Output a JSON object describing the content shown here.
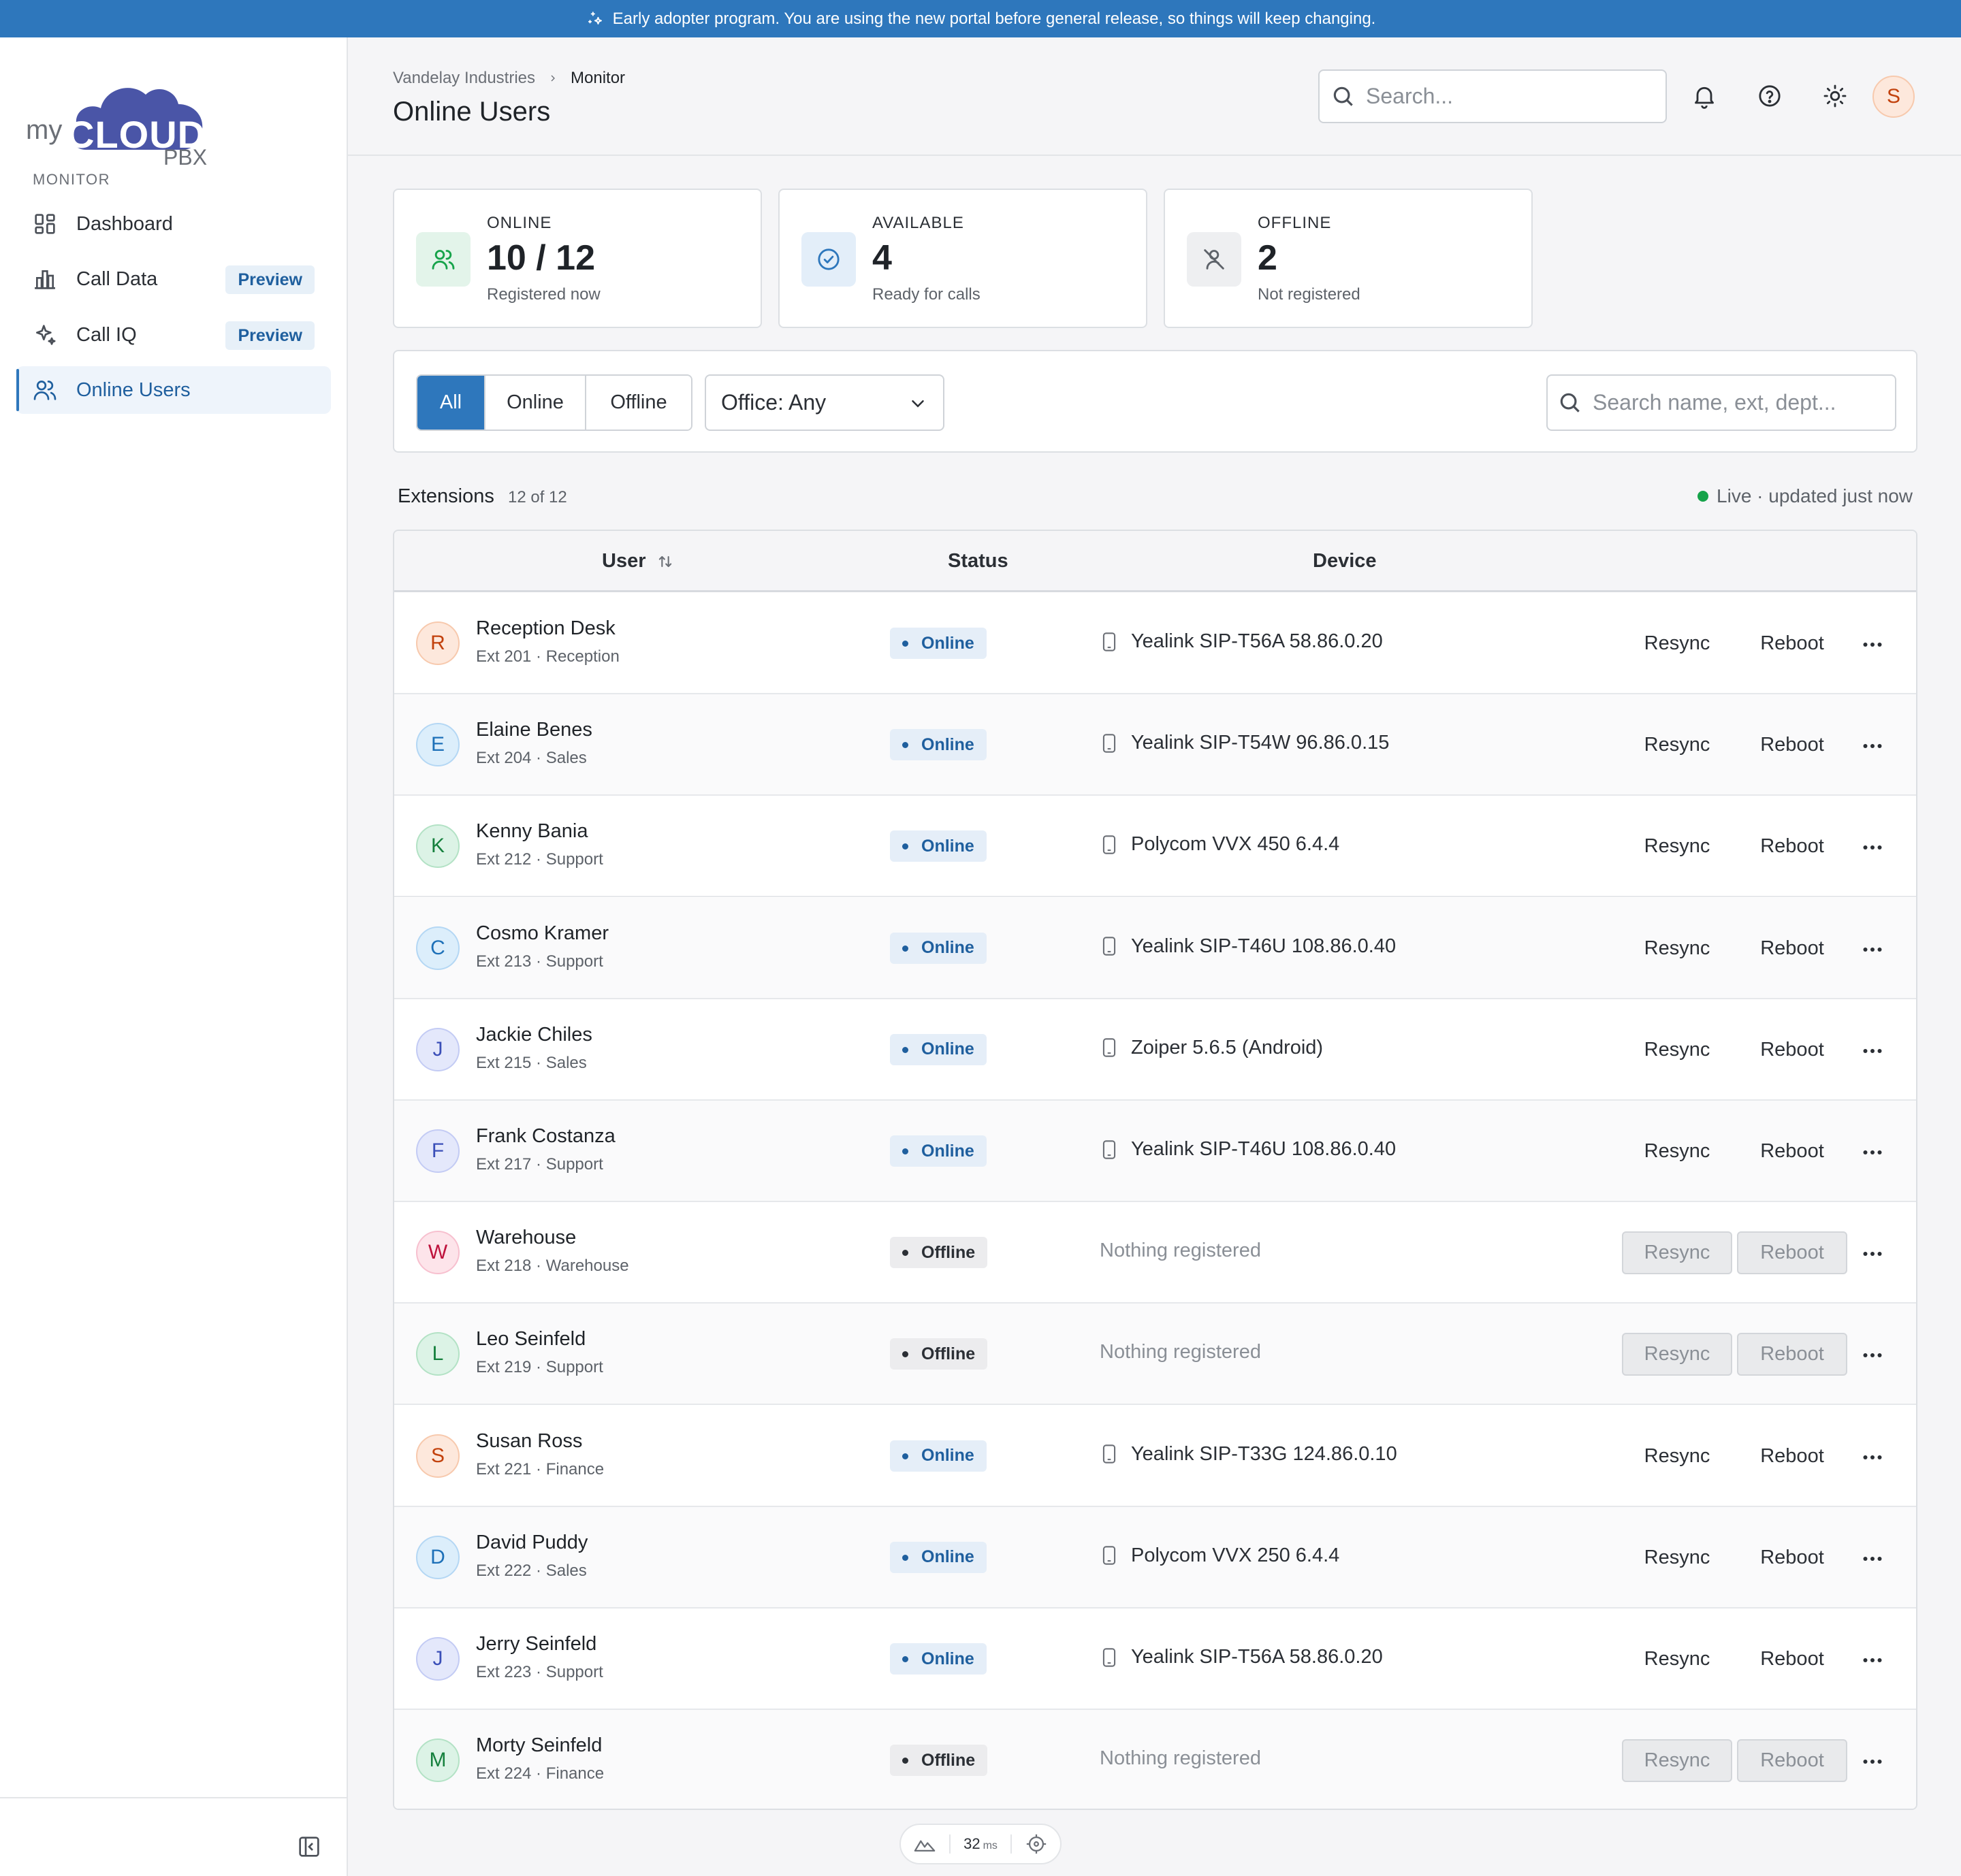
{
  "banner": {
    "text": "Early adopter program. You are using the new portal before general release, so things will keep changing."
  },
  "brand": {
    "prefix": "my",
    "name": "CLOUD",
    "suffix": "PBX",
    "color": "#4a55a7"
  },
  "sidebar": {
    "section": "MONITOR",
    "items": [
      {
        "label": "Dashboard",
        "icon": "dashboard-icon",
        "badge": ""
      },
      {
        "label": "Call Data",
        "icon": "bar-chart-icon",
        "badge": "Preview"
      },
      {
        "label": "Call IQ",
        "icon": "sparkles-icon",
        "badge": "Preview"
      },
      {
        "label": "Online Users",
        "icon": "users-icon",
        "badge": "",
        "active": true
      }
    ]
  },
  "header": {
    "breadcrumb": [
      "Vandelay Industries",
      "Monitor"
    ],
    "title": "Online Users",
    "search_placeholder": "Search...",
    "avatar_initial": "S"
  },
  "stats": [
    {
      "label": "ONLINE",
      "value": "10 / 12",
      "sub": "Registered now",
      "icon": "users-icon",
      "color": "#16a34a"
    },
    {
      "label": "AVAILABLE",
      "value": "4",
      "sub": "Ready for calls",
      "icon": "check-circle-icon",
      "color": "#2e77bc"
    },
    {
      "label": "OFFLINE",
      "value": "2",
      "sub": "Not registered",
      "icon": "user-off-icon",
      "color": "#6b6f76"
    }
  ],
  "filters": {
    "segments": [
      "All",
      "Online",
      "Offline"
    ],
    "active_segment": "All",
    "office": "Office: Any",
    "search_placeholder": "Search name, ext, dept..."
  },
  "extensions": {
    "title": "Extensions",
    "count": "12 of 12",
    "live": "Live · updated just now"
  },
  "table": {
    "columns": [
      "User",
      "Status",
      "Device"
    ],
    "actions": {
      "resync": "Resync",
      "reboot": "Reboot"
    },
    "rows": [
      {
        "initial": "R",
        "name": "Reception Desk",
        "meta": "Ext 201 · Reception",
        "status": "Online",
        "device": "Yealink SIP-T56A 58.86.0.20",
        "avatar": "orange"
      },
      {
        "initial": "E",
        "name": "Elaine Benes",
        "meta": "Ext 204 · Sales",
        "status": "Online",
        "device": "Yealink SIP-T54W 96.86.0.15",
        "avatar": "blue"
      },
      {
        "initial": "K",
        "name": "Kenny Bania",
        "meta": "Ext 212 · Support",
        "status": "Online",
        "device": "Polycom VVX 450 6.4.4",
        "avatar": "green"
      },
      {
        "initial": "C",
        "name": "Cosmo Kramer",
        "meta": "Ext 213 · Support",
        "status": "Online",
        "device": "Yealink SIP-T46U 108.86.0.40",
        "avatar": "blue"
      },
      {
        "initial": "J",
        "name": "Jackie Chiles",
        "meta": "Ext 215 · Sales",
        "status": "Online",
        "device": "Zoiper 5.6.5 (Android)",
        "avatar": "indigo"
      },
      {
        "initial": "F",
        "name": "Frank Costanza",
        "meta": "Ext 217 · Support",
        "status": "Online",
        "device": "Yealink SIP-T46U 108.86.0.40",
        "avatar": "indigo"
      },
      {
        "initial": "W",
        "name": "Warehouse",
        "meta": "Ext 218 · Warehouse",
        "status": "Offline",
        "device": "Nothing registered",
        "avatar": "pink"
      },
      {
        "initial": "L",
        "name": "Leo Seinfeld",
        "meta": "Ext 219 · Support",
        "status": "Offline",
        "device": "Nothing registered",
        "avatar": "green"
      },
      {
        "initial": "S",
        "name": "Susan Ross",
        "meta": "Ext 221 · Finance",
        "status": "Online",
        "device": "Yealink SIP-T33G 124.86.0.10",
        "avatar": "orange"
      },
      {
        "initial": "D",
        "name": "David Puddy",
        "meta": "Ext 222 · Sales",
        "status": "Online",
        "device": "Polycom VVX 250 6.4.4",
        "avatar": "blue"
      },
      {
        "initial": "J",
        "name": "Jerry Seinfeld",
        "meta": "Ext 223 · Support",
        "status": "Online",
        "device": "Yealink SIP-T56A 58.86.0.20",
        "avatar": "indigo"
      },
      {
        "initial": "M",
        "name": "Morty Seinfeld",
        "meta": "Ext 224 · Finance",
        "status": "Offline",
        "device": "Nothing registered",
        "avatar": "green"
      }
    ]
  },
  "footer": {
    "latency": "32",
    "latency_unit": "ms"
  },
  "avatar_colors": {
    "orange": [
      "#fde8dc",
      "#f7c9ad",
      "#c2410c"
    ],
    "blue": [
      "#dceefb",
      "#b4d7f4",
      "#1d70b8"
    ],
    "green": [
      "#dcf3e6",
      "#b3e2c5",
      "#15803d"
    ],
    "indigo": [
      "#e4e8fb",
      "#c3cbf4",
      "#3b4fb8"
    ],
    "pink": [
      "#fde4ea",
      "#f7c0cf",
      "#be123c"
    ]
  }
}
